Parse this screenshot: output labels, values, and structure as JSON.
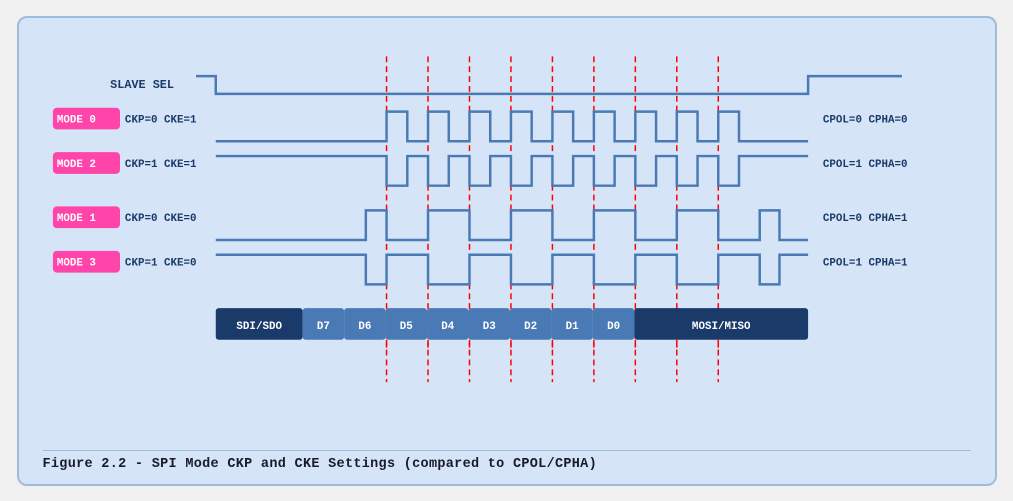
{
  "title": "Figure 2.2 - SPI Mode CKP and CKE Settings (compared to CPOL/CPHA)",
  "caption": "Figure 2.2 - SPI Mode CKP and CKE Settings (compared to CPOL/CPHA)",
  "diagram": {
    "slave_sel_label": "SLAVE SEL",
    "modes": [
      {
        "label": "MODE 0",
        "params": "CKP=0  CKE=1",
        "right": "CPOL=0  CPHA=0"
      },
      {
        "label": "MODE 2",
        "params": "CKP=1  CKE=1",
        "right": "CPOL=1  CPHA=0"
      },
      {
        "label": "MODE 1",
        "params": "CKP=0  CKE=0",
        "right": "CPOL=0  CPHA=1"
      },
      {
        "label": "MODE 3",
        "params": "CKP=1  CKE=0",
        "right": "CPOL=1  CPHA=1"
      }
    ],
    "data_bits": [
      "SDI/SDO",
      "D7",
      "D6",
      "D5",
      "D4",
      "D3",
      "D2",
      "D1",
      "D0",
      "MOSI/MISO"
    ]
  }
}
